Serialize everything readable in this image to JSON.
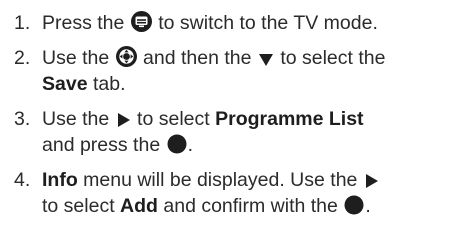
{
  "steps": [
    {
      "number": "1.",
      "text_a": "Press the",
      "icon_1": "tv-guide-button-icon",
      "text_b": "to switch to the TV mode."
    },
    {
      "number": "2.",
      "text_a": "Use the",
      "icon_1": "navigation-cross-button-icon",
      "text_b": "and then the",
      "icon_2": "down-triangle-button-icon",
      "text_c": "to select the",
      "bold_1": "Save",
      "text_d": "tab."
    },
    {
      "number": "3.",
      "text_a": "Use the",
      "icon_1": "right-triangle-button-icon",
      "text_b": "to select",
      "bold_1": "Programme List",
      "text_c": "and press the",
      "icon_2": "ok-circle-button-icon",
      "text_d": "."
    },
    {
      "number": "4.",
      "bold_1": "Info",
      "text_a": "menu will be displayed. Use the",
      "icon_1": "right-triangle-button-icon",
      "text_b": "to select",
      "bold_2": "Add",
      "text_c": "and confirm with the",
      "icon_2": "ok-circle-button-icon",
      "text_d": "."
    }
  ],
  "colors": {
    "text": "#2b2b2b",
    "icon": "#1e1e1e"
  }
}
